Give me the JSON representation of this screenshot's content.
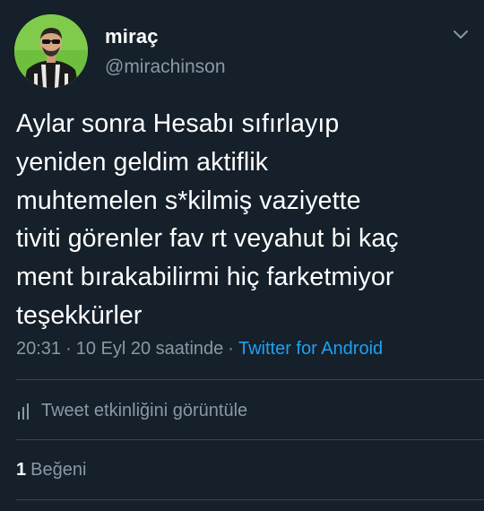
{
  "author": {
    "display_name": "miraç",
    "handle": "@mirachinson",
    "avatar_bg": "#6fbf3f"
  },
  "tweet": {
    "lines": [
      "Aylar sonra Hesabı sıfırlayıp",
      "yeniden geldim aktiflik",
      "muhtemelen s*kilmiş vaziyette",
      "tiviti görenler fav rt veyahut bi kaç",
      "ment bırakabilirmi hiç farketmiyor",
      "teşekkürler"
    ]
  },
  "meta": {
    "time": "20:31",
    "separator": "·",
    "date": "10 Eyl 20 saatinde",
    "source": "Twitter for Android"
  },
  "activity": {
    "label": "Tweet etkinliğini görüntüle",
    "icon": "analytics-bars-icon"
  },
  "likes": {
    "count": "1",
    "label": "Beğeni"
  },
  "colors": {
    "background": "#15202b",
    "text": "#ffffff",
    "secondary": "#8899a6",
    "link": "#1da1f2",
    "divider": "#38444d"
  }
}
